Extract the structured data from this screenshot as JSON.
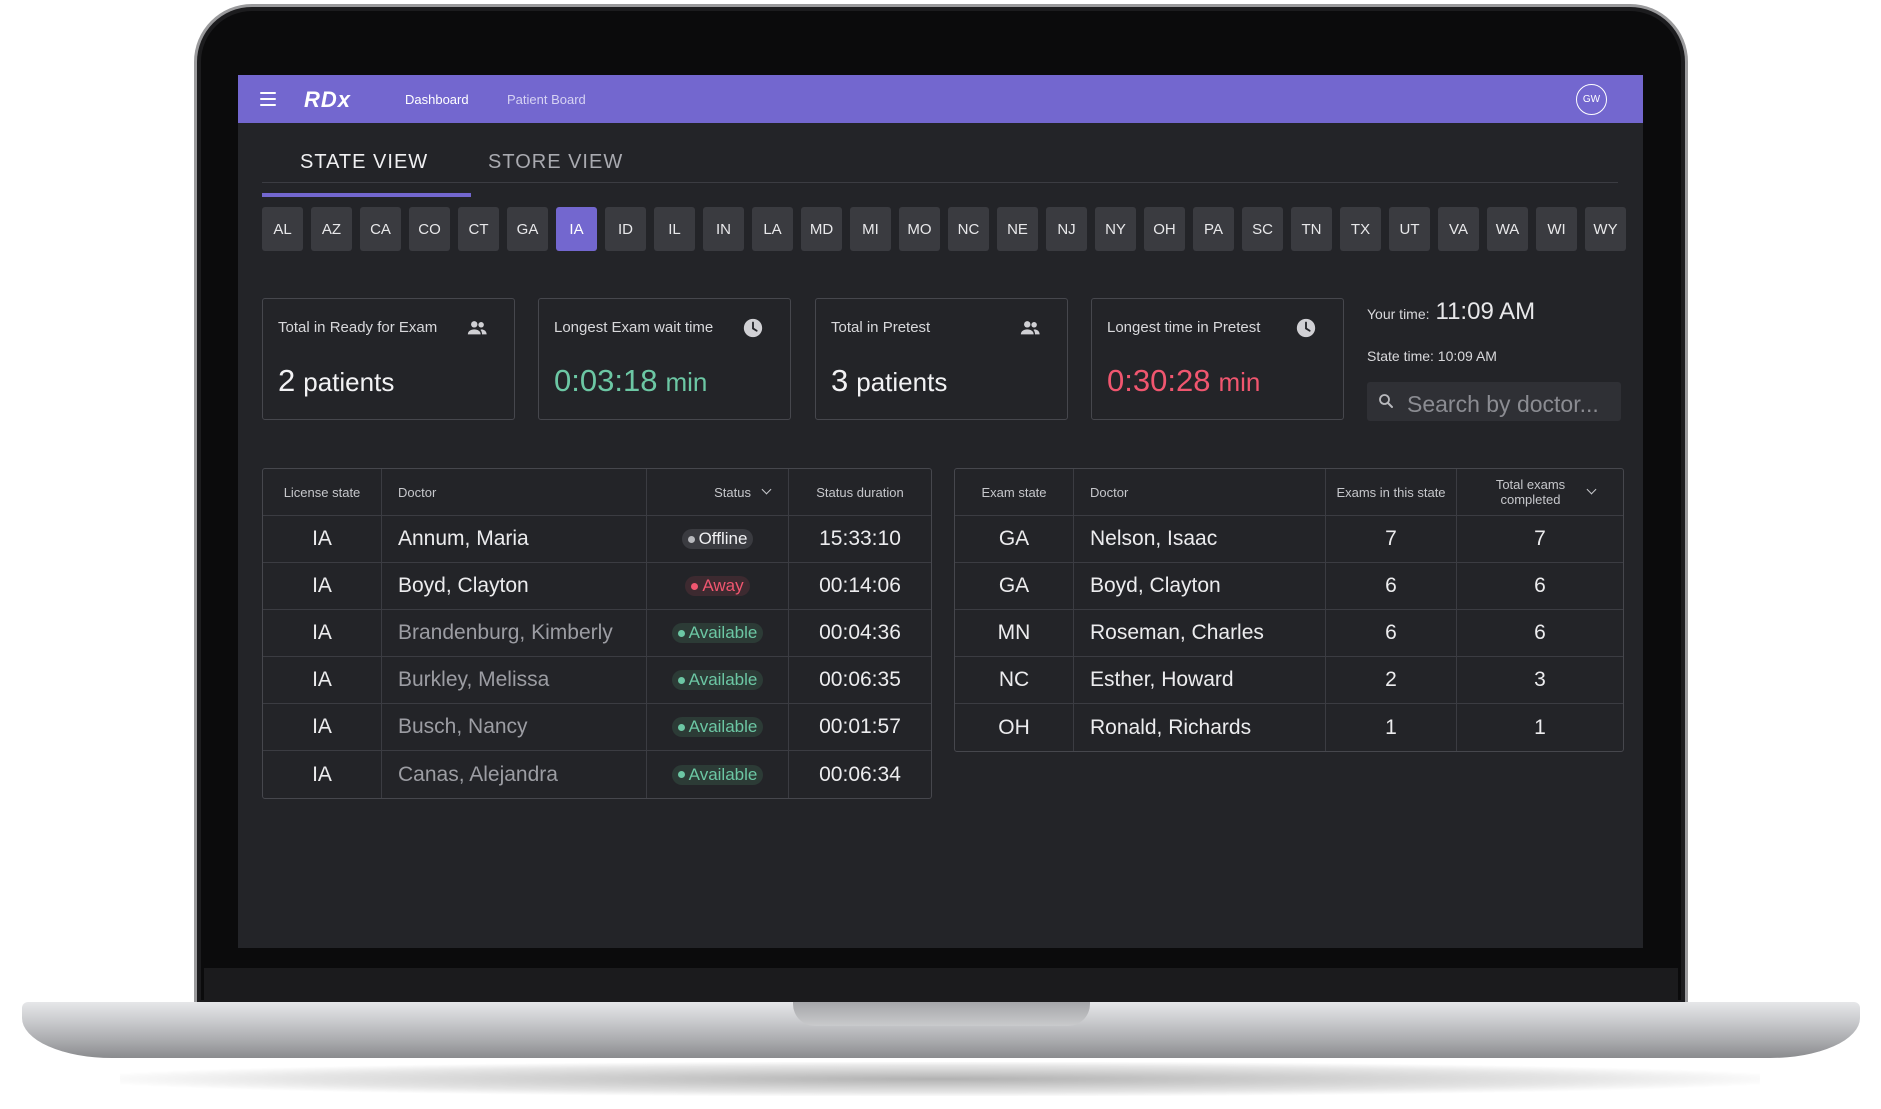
{
  "app": {
    "logo": "RDx",
    "nav": {
      "dashboard": "Dashboard",
      "patient_board": "Patient Board"
    },
    "avatar_initials": "GW"
  },
  "tabs": [
    {
      "label": "STATE VIEW",
      "active": true
    },
    {
      "label": "STORE VIEW",
      "active": false
    }
  ],
  "states": {
    "selected": "IA",
    "list": [
      "AL",
      "AZ",
      "CA",
      "CO",
      "CT",
      "GA",
      "IA",
      "ID",
      "IL",
      "IN",
      "LA",
      "MD",
      "MI",
      "MO",
      "NC",
      "NE",
      "NJ",
      "NY",
      "OH",
      "PA",
      "SC",
      "TN",
      "TX",
      "UT",
      "VA",
      "WA",
      "WI",
      "WY"
    ]
  },
  "cards": [
    {
      "label": "Total in Ready for Exam",
      "value": "2",
      "unit": "patients",
      "icon": "people-icon"
    },
    {
      "label": "Longest Exam wait time",
      "value": "0:03:18",
      "unit": "min",
      "icon": "clock-icon"
    },
    {
      "label": "Total in Pretest",
      "value": "3",
      "unit": "patients",
      "icon": "people-icon"
    },
    {
      "label": "Longest time in Pretest",
      "value": "0:30:28",
      "unit": "min",
      "icon": "clock-icon"
    }
  ],
  "time": {
    "your_time_label": "Your time:",
    "your_time_value": "11:09 AM",
    "state_time": "State time: 10:09 AM",
    "search_placeholder": "Search by doctor..."
  },
  "doctor_table": {
    "headers": [
      "License state",
      "Doctor",
      "Status",
      "Status duration"
    ],
    "rows": [
      {
        "state": "IA",
        "doctor": "Annum, Maria",
        "status": "Offline",
        "duration": "15:33:10"
      },
      {
        "state": "IA",
        "doctor": "Boyd, Clayton",
        "status": "Away",
        "duration": "00:14:06"
      },
      {
        "state": "IA",
        "doctor": "Brandenburg, Kimberly",
        "status": "Available",
        "duration": "00:04:36"
      },
      {
        "state": "IA",
        "doctor": "Burkley, Melissa",
        "status": "Available",
        "duration": "00:06:35"
      },
      {
        "state": "IA",
        "doctor": "Busch, Nancy",
        "status": "Available",
        "duration": "00:01:57"
      },
      {
        "state": "IA",
        "doctor": "Canas, Alejandra",
        "status": "Available",
        "duration": "00:06:34"
      }
    ]
  },
  "exam_table": {
    "headers": [
      "Exam state",
      "Doctor",
      "Exams in this state",
      "Total exams completed"
    ],
    "rows": [
      {
        "state": "GA",
        "doctor": "Nelson, Isaac",
        "exams": "7",
        "total": "7"
      },
      {
        "state": "GA",
        "doctor": "Boyd, Clayton",
        "exams": "6",
        "total": "6"
      },
      {
        "state": "MN",
        "doctor": "Roseman, Charles",
        "exams": "6",
        "total": "6"
      },
      {
        "state": "NC",
        "doctor": "Esther, Howard",
        "exams": "2",
        "total": "3"
      },
      {
        "state": "OH",
        "doctor": "Ronald, Richards",
        "exams": "1",
        "total": "1"
      }
    ]
  },
  "colors": {
    "accent": "#7367cf",
    "available": "#6cc7a4",
    "away": "#f0566f",
    "screen_bg": "#232428"
  }
}
